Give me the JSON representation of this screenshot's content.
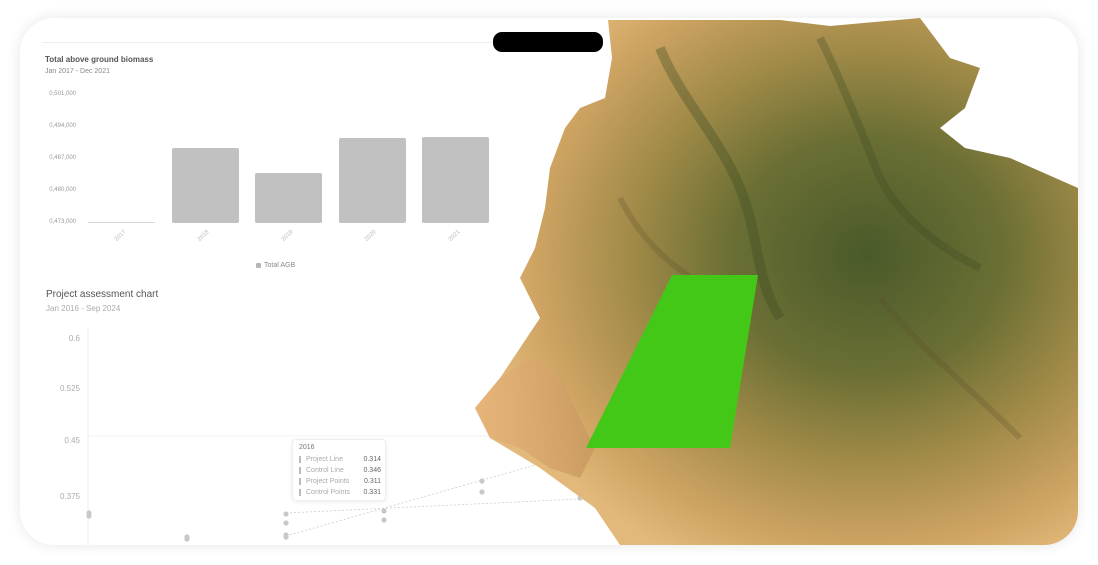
{
  "biomass_chart": {
    "title": "Total above ground biomass",
    "subtitle": "Jan 2017 - Dec 2021",
    "legend": "Total AGB"
  },
  "assessment_chart": {
    "title": "Project assessment chart",
    "subtitle": "Jan 2016 - Sep 2024"
  },
  "tooltip": {
    "year": "2016",
    "rows": [
      {
        "label": "Project Line",
        "value": "0.314"
      },
      {
        "label": "Control Line",
        "value": "0.346"
      },
      {
        "label": "Project Points",
        "value": "0.311"
      },
      {
        "label": "Control Points",
        "value": "0.331"
      }
    ]
  },
  "colors": {
    "bar": "#c1c1c1",
    "project_area": "#43c817"
  },
  "chart_data": [
    {
      "type": "bar",
      "title": "Total above ground biomass",
      "subtitle": "Jan 2017 - Dec 2021",
      "categories": [
        "2017",
        "2018",
        "2019",
        "2020",
        "2021"
      ],
      "series": [
        {
          "name": "Total AGB",
          "values": [
            473000,
            489500,
            484000,
            491500,
            491800
          ]
        }
      ],
      "ylim": [
        473000,
        501000
      ],
      "yticks": [
        "0,473,000",
        "0,480,000",
        "0,487,000",
        "0,494,000",
        "0,501,000"
      ],
      "legend_position": "bottom"
    },
    {
      "type": "scatter",
      "title": "Project assessment chart",
      "subtitle": "Jan 2016 - Sep 2024",
      "yticks": [
        "0.6",
        "0.525",
        "0.45",
        "0.375"
      ],
      "series": [
        {
          "name": "Project Line",
          "values": [
            0.314
          ]
        },
        {
          "name": "Control Line",
          "values": [
            0.346
          ]
        },
        {
          "name": "Project Points",
          "values": [
            0.311
          ]
        },
        {
          "name": "Control Points",
          "values": [
            0.331
          ]
        }
      ]
    }
  ]
}
